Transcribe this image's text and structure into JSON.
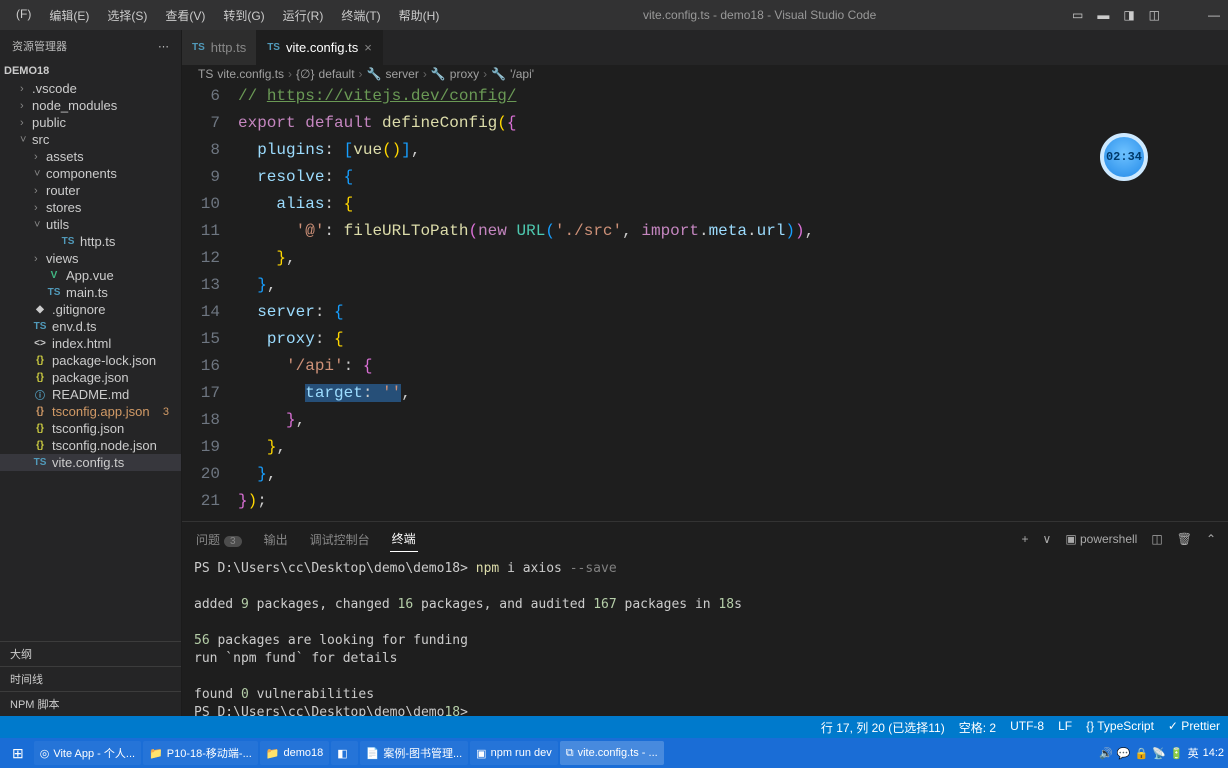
{
  "menu": [
    "(F)",
    "编辑(E)",
    "选择(S)",
    "查看(V)",
    "转到(G)",
    "运行(R)",
    "终端(T)",
    "帮助(H)"
  ],
  "titlecenter": "vite.config.ts - demo18 - Visual Studio Code",
  "explorer": {
    "title": "资源管理器",
    "project": "DEMO18",
    "items": [
      {
        "name": ".vscode",
        "type": "folder",
        "open": false,
        "depth": 1
      },
      {
        "name": "node_modules",
        "type": "folder",
        "open": false,
        "depth": 1
      },
      {
        "name": "public",
        "type": "folder",
        "open": false,
        "depth": 1
      },
      {
        "name": "src",
        "type": "folder",
        "open": true,
        "depth": 1
      },
      {
        "name": "assets",
        "type": "folder",
        "open": false,
        "depth": 2
      },
      {
        "name": "components",
        "type": "folder",
        "open": true,
        "depth": 2
      },
      {
        "name": "router",
        "type": "folder",
        "open": false,
        "depth": 2
      },
      {
        "name": "stores",
        "type": "folder",
        "open": false,
        "depth": 2
      },
      {
        "name": "utils",
        "type": "folder",
        "open": true,
        "depth": 2
      },
      {
        "name": "http.ts",
        "type": "file",
        "ic": "TS",
        "cls": "fic-ts",
        "depth": 3
      },
      {
        "name": "views",
        "type": "folder",
        "open": false,
        "depth": 2
      },
      {
        "name": "App.vue",
        "type": "file",
        "ic": "V",
        "cls": "fic-vue",
        "depth": 2
      },
      {
        "name": "main.ts",
        "type": "file",
        "ic": "TS",
        "cls": "fic-ts",
        "depth": 2
      },
      {
        "name": ".gitignore",
        "type": "file",
        "ic": "◆",
        "cls": "",
        "depth": 1
      },
      {
        "name": "env.d.ts",
        "type": "file",
        "ic": "TS",
        "cls": "fic-ts",
        "depth": 1
      },
      {
        "name": "index.html",
        "type": "file",
        "ic": "<>",
        "cls": "",
        "depth": 1
      },
      {
        "name": "package-lock.json",
        "type": "file",
        "ic": "{}",
        "cls": "fic-json",
        "depth": 1
      },
      {
        "name": "package.json",
        "type": "file",
        "ic": "{}",
        "cls": "fic-json",
        "depth": 1
      },
      {
        "name": "README.md",
        "type": "file",
        "ic": "ⓘ",
        "cls": "fic-md",
        "depth": 1
      },
      {
        "name": "tsconfig.app.json",
        "type": "file",
        "ic": "{}",
        "cls": "fic-warn",
        "depth": 1,
        "warn": "3"
      },
      {
        "name": "tsconfig.json",
        "type": "file",
        "ic": "{}",
        "cls": "fic-json",
        "depth": 1
      },
      {
        "name": "tsconfig.node.json",
        "type": "file",
        "ic": "{}",
        "cls": "fic-json",
        "depth": 1
      },
      {
        "name": "vite.config.ts",
        "type": "file",
        "ic": "TS",
        "cls": "fic-ts",
        "depth": 1,
        "active": true
      }
    ],
    "sections": [
      "大纲",
      "时间线",
      "NPM 脚本"
    ]
  },
  "tabs": [
    {
      "label": "http.ts",
      "active": false
    },
    {
      "label": "vite.config.ts",
      "active": true
    }
  ],
  "breadcrumb": [
    "TS",
    "vite.config.ts",
    ">",
    "{∅}",
    "default",
    ">",
    "🔧",
    "server",
    ">",
    "🔧",
    "proxy",
    ">",
    "🔧",
    "'/api'"
  ],
  "gutter": [
    "6",
    "7",
    "8",
    "9",
    "10",
    "11",
    "12",
    "13",
    "14",
    "15",
    "16",
    "17",
    "18",
    "19",
    "20",
    "21"
  ],
  "codehtml": [
    "<span class='tok-comment'>// </span><span class='tok-link'>https://vitejs.dev/config/</span>",
    "<span class='tok-kw'>export</span> <span class='tok-kw'>default</span> <span class='tok-func'>defineConfig</span><span class='tok-brack2'>(</span><span class='tok-brack'>{</span>",
    "  <span class='tok-var'>plugins</span><span class='tok-punc'>:</span> <span class='tok-brack3'>[</span><span class='tok-func'>vue</span><span class='tok-brack2'>()</span><span class='tok-brack3'>]</span><span class='tok-punc'>,</span>",
    "  <span class='tok-var'>resolve</span><span class='tok-punc'>:</span> <span class='tok-brack3'>{</span>",
    "    <span class='tok-var'>alias</span><span class='tok-punc'>:</span> <span class='tok-brack2'>{</span>",
    "      <span class='tok-str'>'@'</span><span class='tok-punc'>:</span> <span class='tok-func'>fileURLToPath</span><span class='tok-brack'>(</span><span class='tok-kw'>new</span> <span class='tok-type'>URL</span><span class='tok-brack3'>(</span><span class='tok-str'>'./src'</span><span class='tok-punc'>,</span> <span class='tok-kw'>import</span><span class='tok-punc'>.</span><span class='tok-var'>meta</span><span class='tok-punc'>.</span><span class='tok-var'>url</span><span class='tok-brack3'>)</span><span class='tok-brack'>)</span><span class='tok-punc'>,</span>",
    "    <span class='tok-brack2'>}</span><span class='tok-punc'>,</span>",
    "  <span class='tok-brack3'>}</span><span class='tok-punc'>,</span>",
    "  <span class='tok-var'>server</span><span class='tok-punc'>:</span> <span class='tok-brack3'>{</span>",
    "   <span class='tok-var'>proxy</span><span class='tok-punc'>:</span> <span class='tok-brack2'>{</span>",
    "     <span class='tok-str'>'/api'</span><span class='tok-punc'>:</span> <span class='tok-brack'>{</span>",
    "       <span class='sel'><span class='tok-var'>target</span><span class='tok-punc'>:</span> <span class='tok-str'>''</span></span><span class='tok-punc'>,</span>",
    "     <span class='tok-brack'>}</span><span class='tok-punc'>,</span>",
    "   <span class='tok-brack2'>}</span><span class='tok-punc'>,</span>",
    "  <span class='tok-brack3'>}</span><span class='tok-punc'>,</span>",
    "<span class='tok-brack'>}</span><span class='tok-brack2'>)</span><span class='tok-punc'>;</span>"
  ],
  "timer": "02:34",
  "panel": {
    "tabs": [
      {
        "label": "问题",
        "count": "3"
      },
      {
        "label": "输出"
      },
      {
        "label": "调试控制台"
      },
      {
        "label": "终端",
        "active": true
      }
    ],
    "shell": "powershell",
    "terminal": [
      "PS D:\\Users\\cc\\Desktop\\demo\\demo18> npm i axios --save",
      "",
      "added 9 packages, changed 16 packages, and audited 167 packages in 18s",
      "",
      "56 packages are looking for funding",
      "  run `npm fund` for details",
      "",
      "found 0 vulnerabilities",
      "PS D:\\Users\\cc\\Desktop\\demo\\demo18> "
    ]
  },
  "status": {
    "left": [],
    "right": [
      "行 17, 列 20 (已选择11)",
      "空格: 2",
      "UTF-8",
      "LF",
      "{} TypeScript",
      "✓ Prettier"
    ]
  },
  "taskbar": {
    "items": [
      {
        "label": "Vite App - 个人...",
        "ic": "◎"
      },
      {
        "label": "P10-18-移动端-...",
        "ic": "📁"
      },
      {
        "label": "demo18",
        "ic": "📁"
      },
      {
        "label": "",
        "ic": "◧"
      },
      {
        "label": "案例-图书管理...",
        "ic": "📄"
      },
      {
        "label": "npm run dev",
        "ic": "▣"
      },
      {
        "label": "vite.config.ts - ...",
        "ic": "⧉",
        "active": true
      }
    ],
    "right": [
      "🔊",
      "💬",
      "🔒",
      "📡",
      "🔋",
      "英",
      "14:2"
    ]
  }
}
